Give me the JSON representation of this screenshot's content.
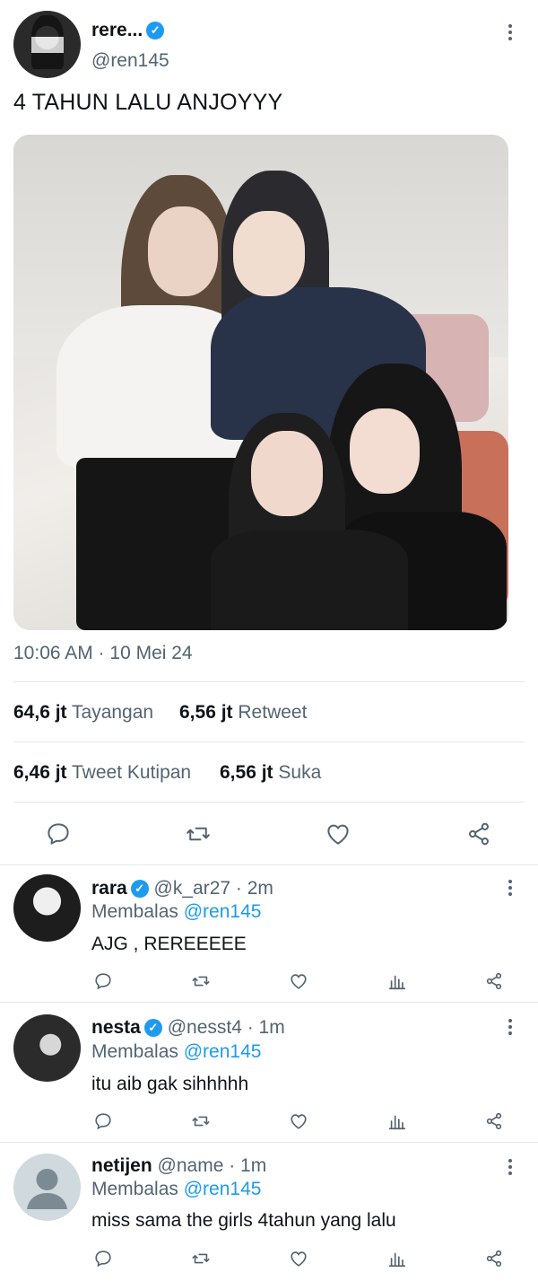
{
  "tweet": {
    "author_name": "rere...",
    "author_handle": "@ren145",
    "text": "4 TAHUN LALU ANJOYYY",
    "timestamp": "10:06 AM · 10 Mei 24",
    "stats": {
      "views_value": "64,6 jt",
      "views_label": "Tayangan",
      "retweets_value": "6,56 jt",
      "retweets_label": "Retweet",
      "quotes_value": "6,46 jt",
      "quotes_label": "Tweet Kutipan",
      "likes_value": "6,56 jt",
      "likes_label": "Suka"
    },
    "actions": [
      "reply-icon",
      "retweet-icon",
      "like-icon",
      "share-icon"
    ]
  },
  "replies": [
    {
      "name": "rara",
      "handle": "@k_ar27 · 2m",
      "replying_prefix": "Membalas",
      "replying_to": "@ren145",
      "text": "AJG , REREEEEE",
      "verified": true
    },
    {
      "name": "nesta",
      "handle": "@nesst4 · 1m",
      "replying_prefix": "Membalas",
      "replying_to": "@ren145",
      "text": "itu aib gak sihhhhh",
      "verified": true
    },
    {
      "name": "netijen",
      "handle": "@name · 1m",
      "replying_prefix": "Membalas",
      "replying_to": "@ren145",
      "text": "miss sama the girls 4tahun yang lalu",
      "verified": false
    }
  ],
  "colors": {
    "accent": "#1d9bf0",
    "secondary_text": "#536471",
    "divider": "#e4e8eb"
  }
}
